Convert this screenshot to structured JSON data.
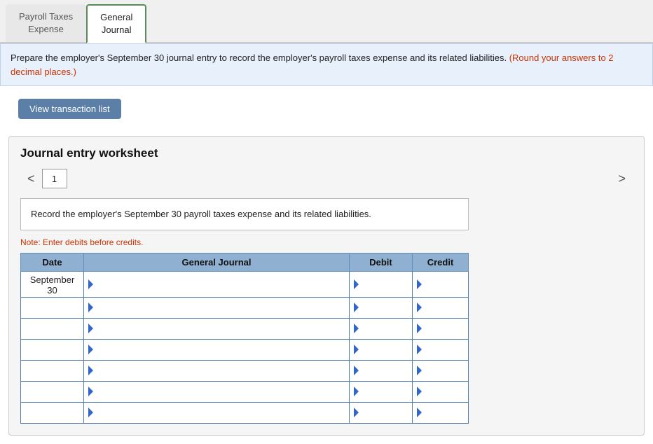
{
  "tabs": [
    {
      "id": "payroll-taxes",
      "label": "Payroll Taxes\nExpense",
      "active": false
    },
    {
      "id": "general-journal",
      "label": "General\nJournal",
      "active": true
    }
  ],
  "instructions": {
    "main_text": "Prepare the employer's September 30 journal entry to record the employer's payroll taxes expense and its related liabilities.",
    "round_note": "(Round your answers to 2 decimal places.)"
  },
  "button": {
    "view_transaction_list": "View transaction list"
  },
  "worksheet": {
    "title": "Journal entry worksheet",
    "current_page": "1",
    "nav_left": "<",
    "nav_right": ">",
    "description": "Record the employer's September 30 payroll taxes expense and its related liabilities.",
    "note": "Note: Enter debits before credits.",
    "table": {
      "headers": [
        "Date",
        "General Journal",
        "Debit",
        "Credit"
      ],
      "rows": [
        {
          "date": "September\n30",
          "journal": "",
          "debit": "",
          "credit": ""
        },
        {
          "date": "",
          "journal": "",
          "debit": "",
          "credit": ""
        },
        {
          "date": "",
          "journal": "",
          "debit": "",
          "credit": ""
        },
        {
          "date": "",
          "journal": "",
          "debit": "",
          "credit": ""
        },
        {
          "date": "",
          "journal": "",
          "debit": "",
          "credit": ""
        },
        {
          "date": "",
          "journal": "",
          "debit": "",
          "credit": ""
        },
        {
          "date": "",
          "journal": "",
          "debit": "",
          "credit": ""
        }
      ]
    }
  }
}
